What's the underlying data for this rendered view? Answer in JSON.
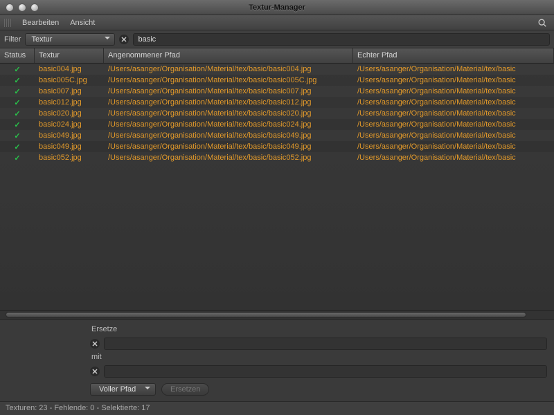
{
  "window": {
    "title": "Textur-Manager"
  },
  "menu": {
    "edit": "Bearbeiten",
    "view": "Ansicht"
  },
  "filter": {
    "label": "Filter",
    "dropdown": "Textur",
    "value": "basic"
  },
  "columns": {
    "status": "Status",
    "textur": "Textur",
    "assumed": "Angenommener Pfad",
    "real": "Echter Pfad"
  },
  "rows": [
    {
      "tex": "basic004.jpg",
      "assumed": "/Users/asanger/Organisation/Material/tex/basic/basic004.jpg",
      "real": "/Users/asanger/Organisation/Material/tex/basic"
    },
    {
      "tex": "basic005C.jpg",
      "assumed": "/Users/asanger/Organisation/Material/tex/basic/basic005C.jpg",
      "real": "/Users/asanger/Organisation/Material/tex/basic"
    },
    {
      "tex": "basic007.jpg",
      "assumed": "/Users/asanger/Organisation/Material/tex/basic/basic007.jpg",
      "real": "/Users/asanger/Organisation/Material/tex/basic"
    },
    {
      "tex": "basic012.jpg",
      "assumed": "/Users/asanger/Organisation/Material/tex/basic/basic012.jpg",
      "real": "/Users/asanger/Organisation/Material/tex/basic"
    },
    {
      "tex": "basic020.jpg",
      "assumed": "/Users/asanger/Organisation/Material/tex/basic/basic020.jpg",
      "real": "/Users/asanger/Organisation/Material/tex/basic"
    },
    {
      "tex": "basic024.jpg",
      "assumed": "/Users/asanger/Organisation/Material/tex/basic/basic024.jpg",
      "real": "/Users/asanger/Organisation/Material/tex/basic"
    },
    {
      "tex": "basic049.jpg",
      "assumed": "/Users/asanger/Organisation/Material/tex/basic/basic049.jpg",
      "real": "/Users/asanger/Organisation/Material/tex/basic"
    },
    {
      "tex": "basic049.jpg",
      "assumed": "/Users/asanger/Organisation/Material/tex/basic/basic049.jpg",
      "real": "/Users/asanger/Organisation/Material/tex/basic"
    },
    {
      "tex": "basic052.jpg",
      "assumed": "/Users/asanger/Organisation/Material/tex/basic/basic052.jpg",
      "real": "/Users/asanger/Organisation/Material/tex/basic"
    }
  ],
  "replace": {
    "label_replace": "Ersetze",
    "label_with": "mit",
    "mode": "Voller Pfad",
    "button": "Ersetzen"
  },
  "status": "Texturen: 23 - Fehlende: 0 - Selektierte: 17"
}
